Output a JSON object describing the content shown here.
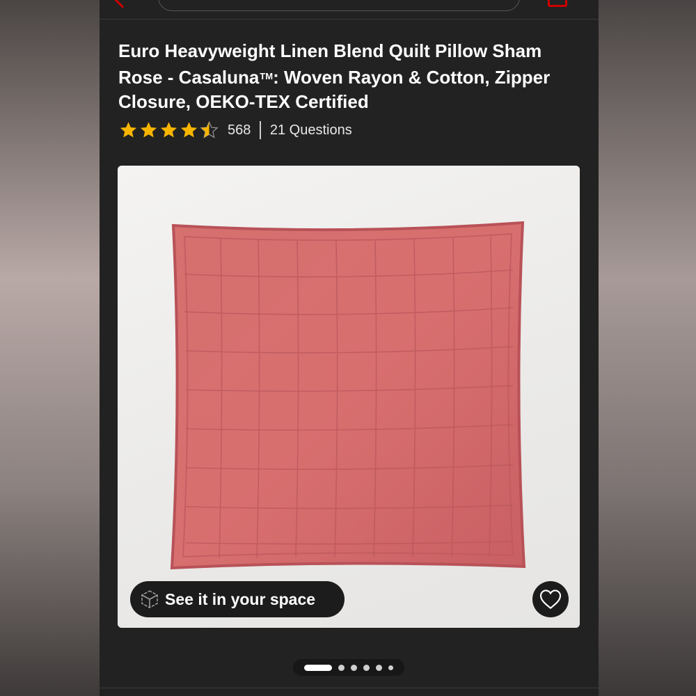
{
  "product": {
    "title": "Euro Heavyweight Linen Blend Quilt Pillow Sham Rose - Casaluna",
    "title_suffix": ": Woven Rayon & Cotton, Zipper Closure, OEKO-TEX Certified",
    "trademark": "TM",
    "rating": 4.5,
    "rating_count": "568",
    "questions": "21 Questions"
  },
  "image_card": {
    "ar_button_label": "See it in your space",
    "ar_icon": "cube-ar-icon",
    "favorite_icon": "heart-icon"
  },
  "carousel": {
    "total": 6,
    "active_index": 0
  },
  "colors": {
    "brand_red": "#cc0000",
    "star_gold": "#f7b500",
    "pillow_rose": "#d26a6d",
    "background": "#222222"
  }
}
